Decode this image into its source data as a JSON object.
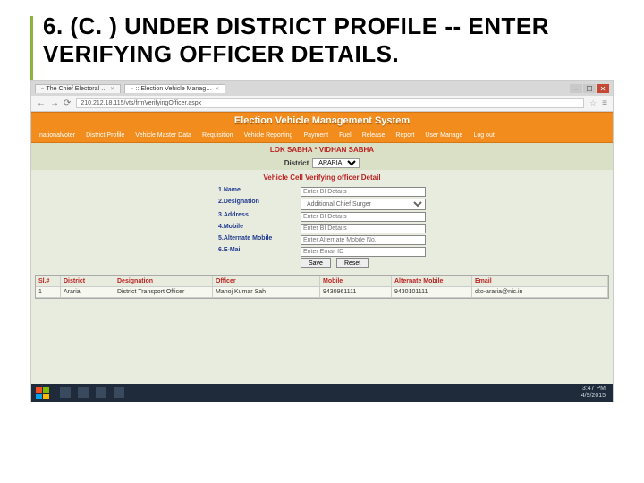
{
  "slide": {
    "title": "6. (C. )  UNDER DISTRICT PROFILE --  ENTER VERIFYING OFFICER DETAILS."
  },
  "browser": {
    "tab1": "The Chief Electoral …",
    "tab2": ":: Election Vehicle Manag…",
    "url": "210.212.18.115/vts/frmVerifyingOfficer.aspx"
  },
  "app": {
    "title": "Election Vehicle Management System",
    "menu": [
      "nationalvoter",
      "District Profile",
      "Vehicle Master Data",
      "Requisition",
      "Vehicle Reporting",
      "Payment",
      "Fuel",
      "Release",
      "Report",
      "User Manage",
      "Log out"
    ],
    "subheader": {
      "label": "LOK SABHA * VIDHAN SABHA"
    },
    "district": {
      "label": "District",
      "value": "ARARIA"
    },
    "form_title": "Vehicle Cell Verifying officer Detail",
    "fields": {
      "f1": {
        "label": "1.Name",
        "placeholder": "Enter BI Details"
      },
      "f2": {
        "label": "2.Designation",
        "value": "Additional Chief Surger"
      },
      "f3": {
        "label": "3.Address",
        "placeholder": "Enter BI Details"
      },
      "f4": {
        "label": "4.Mobile",
        "placeholder": "Enter BI Details"
      },
      "f5": {
        "label": "5.Alternate Mobile",
        "placeholder": "Enter Alternate Mobile No."
      },
      "f6": {
        "label": "6.E-Mail",
        "placeholder": "Enter Email ID"
      },
      "save": "Save",
      "reset": "Reset"
    },
    "table": {
      "head": [
        "Sl.#",
        "District",
        "Designation",
        "Officer",
        "Mobile",
        "Alternate Mobile",
        "Email"
      ],
      "row": [
        "1",
        "Araria",
        "District Transport Officer",
        "Manoj Kumar Sah",
        "9430961111",
        "9430101111",
        "dto-araria@nic.in"
      ]
    }
  },
  "taskbar": {
    "time": "3:47 PM",
    "date": "4/9/2015"
  }
}
